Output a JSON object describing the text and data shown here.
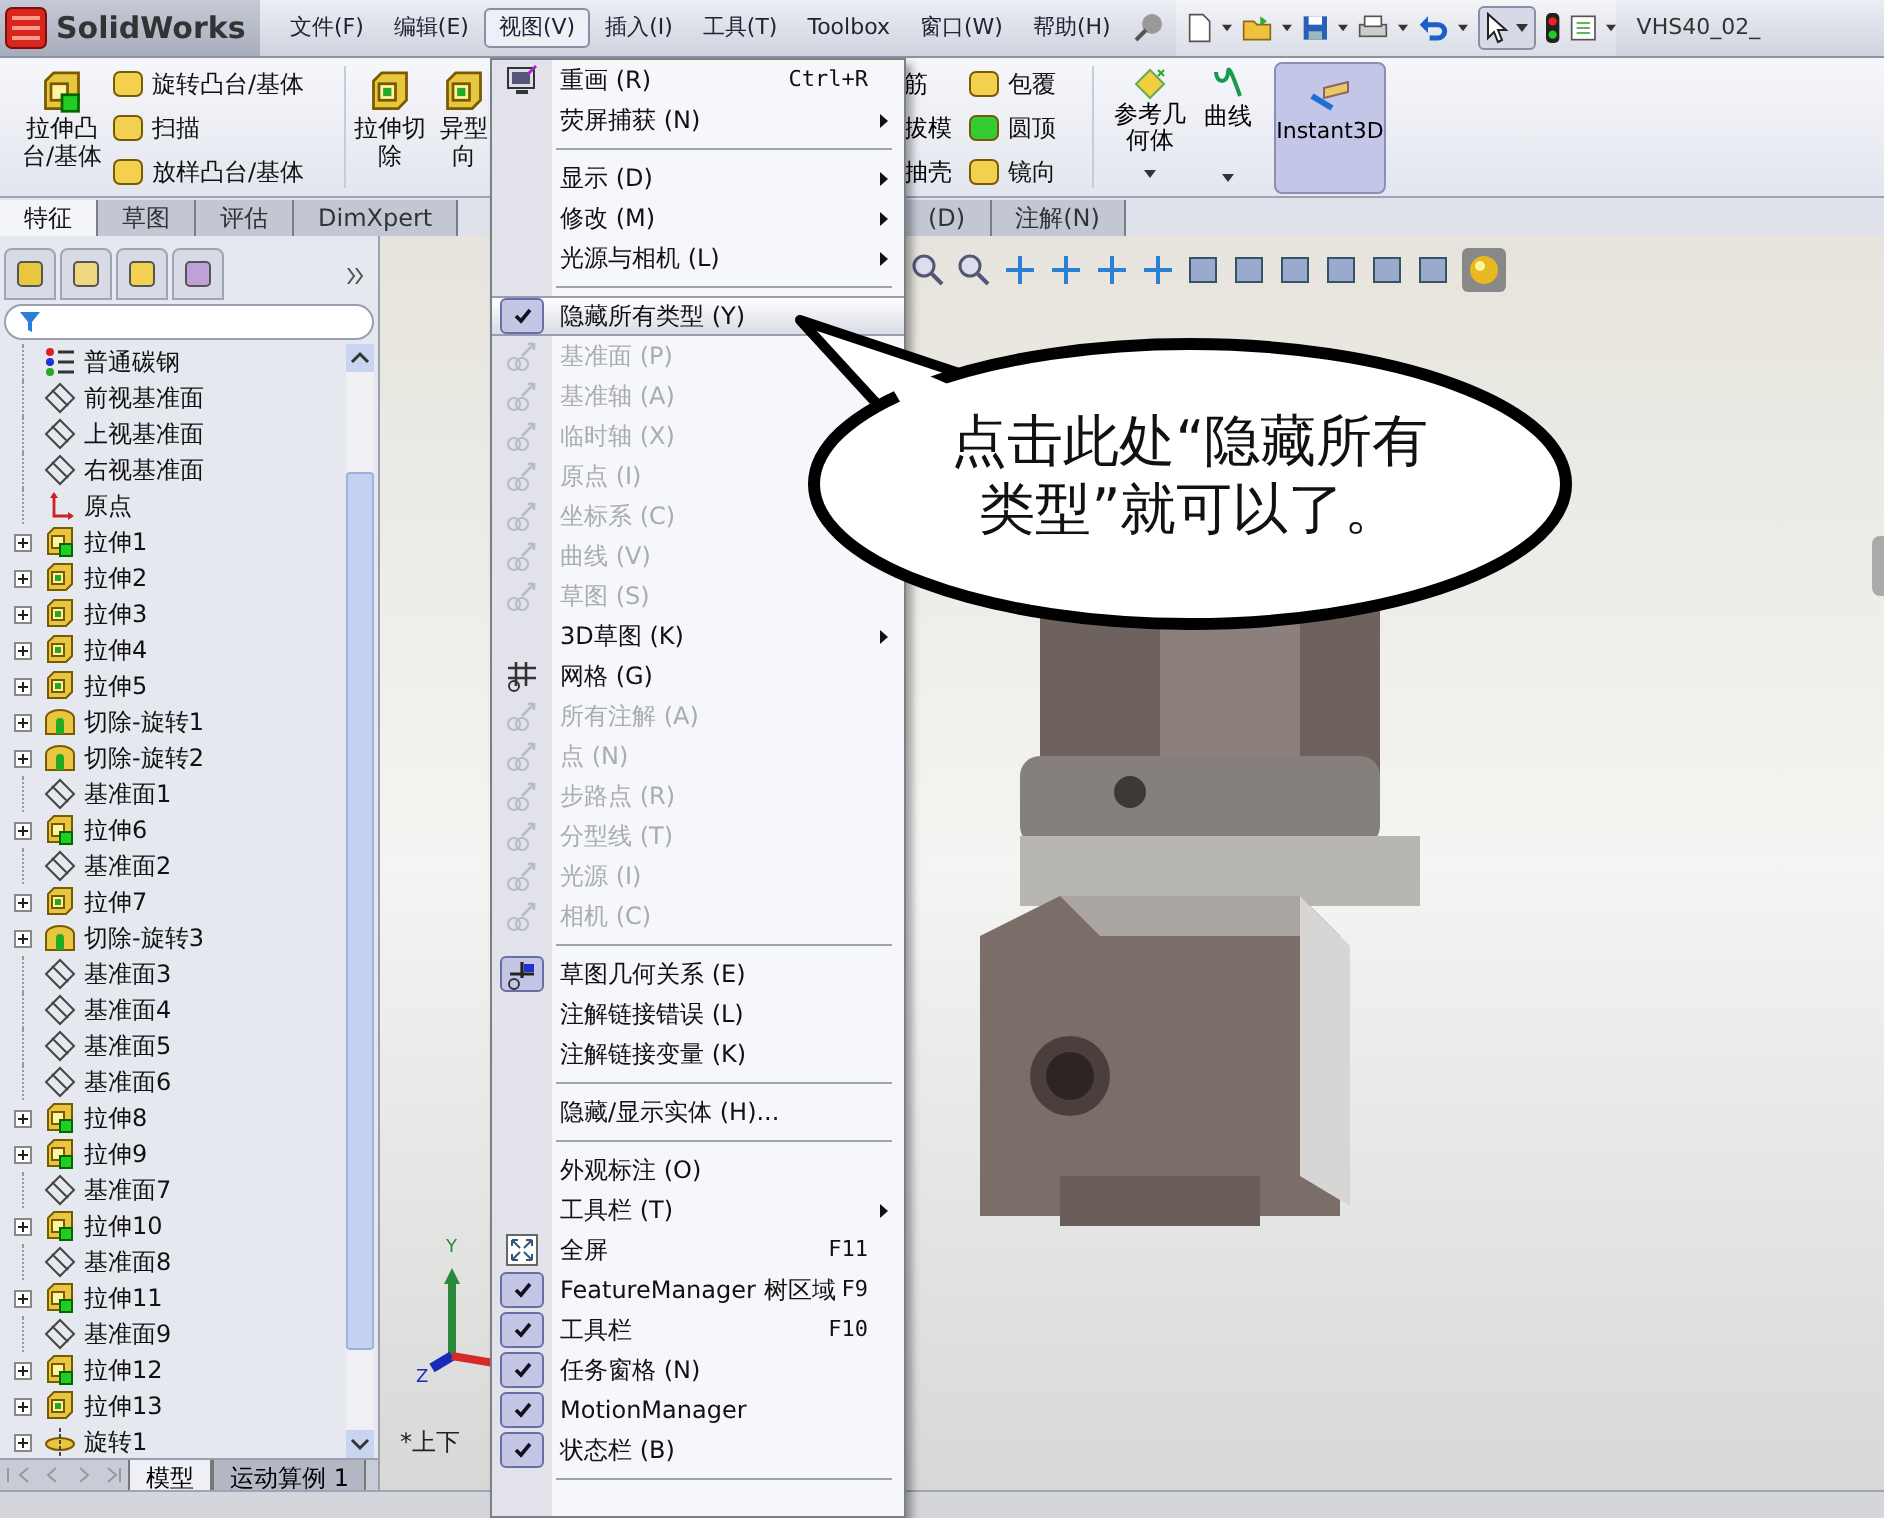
{
  "title_bar": {
    "app_name": "SolidWorks",
    "document": "VHS40_02_"
  },
  "menu_bar": [
    {
      "label": "文件(F)",
      "selected": false
    },
    {
      "label": "编辑(E)",
      "selected": false
    },
    {
      "label": "视图(V)",
      "selected": true
    },
    {
      "label": "插入(I)",
      "selected": false
    },
    {
      "label": "工具(T)",
      "selected": false
    },
    {
      "label": "Toolbox",
      "selected": false
    },
    {
      "label": "窗口(W)",
      "selected": false
    },
    {
      "label": "帮助(H)",
      "selected": false
    }
  ],
  "ribbon": {
    "left_large": "拉伸凸台/基体",
    "left_small": [
      "旋转凸台/基体",
      "扫描",
      "放样凸台/基体"
    ],
    "cut_large": "拉伸切除",
    "hole_partial": "异型向",
    "right_small_a": [
      "筋",
      "拔模",
      "抽壳"
    ],
    "right_small_b": [
      "包覆",
      "圆顶",
      "镜向"
    ],
    "reference": "参考几何体",
    "curves": "曲线",
    "instant3d": {
      "label": "Instant3D",
      "on": true
    }
  },
  "ribbon_tabs_left": [
    {
      "label": "特征",
      "selected": true
    },
    {
      "label": "草图",
      "selected": false
    },
    {
      "label": "评估",
      "selected": false
    },
    {
      "label": "DimXpert",
      "selected": false
    }
  ],
  "ribbon_tabs_right": [
    {
      "label": "(D)",
      "selected": false
    },
    {
      "label": "注解(N)",
      "selected": false
    }
  ],
  "feature_tree": [
    {
      "label": "普通碳钢",
      "kind": "material",
      "expandable": false
    },
    {
      "label": "前视基准面",
      "kind": "plane",
      "expandable": false
    },
    {
      "label": "上视基准面",
      "kind": "plane",
      "expandable": false
    },
    {
      "label": "右视基准面",
      "kind": "plane",
      "expandable": false
    },
    {
      "label": "原点",
      "kind": "origin",
      "expandable": false
    },
    {
      "label": "拉伸1",
      "kind": "boss",
      "expandable": true
    },
    {
      "label": "拉伸2",
      "kind": "extrude",
      "expandable": true
    },
    {
      "label": "拉伸3",
      "kind": "extrude",
      "expandable": true
    },
    {
      "label": "拉伸4",
      "kind": "extrude",
      "expandable": true
    },
    {
      "label": "拉伸5",
      "kind": "extrude",
      "expandable": true
    },
    {
      "label": "切除-旋转1",
      "kind": "revolve_cut",
      "expandable": true
    },
    {
      "label": "切除-旋转2",
      "kind": "revolve_cut",
      "expandable": true
    },
    {
      "label": "基准面1",
      "kind": "plane",
      "expandable": false
    },
    {
      "label": "拉伸6",
      "kind": "boss",
      "expandable": true
    },
    {
      "label": "基准面2",
      "kind": "plane",
      "expandable": false
    },
    {
      "label": "拉伸7",
      "kind": "extrude",
      "expandable": true
    },
    {
      "label": "切除-旋转3",
      "kind": "revolve_cut",
      "expandable": true
    },
    {
      "label": "基准面3",
      "kind": "plane",
      "expandable": false
    },
    {
      "label": "基准面4",
      "kind": "plane",
      "expandable": false
    },
    {
      "label": "基准面5",
      "kind": "plane",
      "expandable": false
    },
    {
      "label": "基准面6",
      "kind": "plane",
      "expandable": false
    },
    {
      "label": "拉伸8",
      "kind": "boss",
      "expandable": true
    },
    {
      "label": "拉伸9",
      "kind": "boss",
      "expandable": true
    },
    {
      "label": "基准面7",
      "kind": "plane",
      "expandable": false
    },
    {
      "label": "拉伸10",
      "kind": "boss",
      "expandable": true
    },
    {
      "label": "基准面8",
      "kind": "plane",
      "expandable": false
    },
    {
      "label": "拉伸11",
      "kind": "boss",
      "expandable": true
    },
    {
      "label": "基准面9",
      "kind": "plane",
      "expandable": false
    },
    {
      "label": "拉伸12",
      "kind": "boss",
      "expandable": true
    },
    {
      "label": "拉伸13",
      "kind": "extrude",
      "expandable": true
    },
    {
      "label": "旋转1",
      "kind": "revolve",
      "expandable": true
    }
  ],
  "bottom_tabs": [
    {
      "label": "模型",
      "selected": true
    },
    {
      "label": "运动算例 1",
      "selected": false
    }
  ],
  "view_menu": [
    {
      "kind": "redraw",
      "label": "重画 (R)",
      "shortcut": "Ctrl+R",
      "submenu": false,
      "disabled": false,
      "checked": false,
      "highlighted": false
    },
    {
      "kind": "plain",
      "label": "荧屏捕获 (N)",
      "submenu": true,
      "disabled": false,
      "checked": false,
      "highlighted": false
    },
    {
      "kind": "separator"
    },
    {
      "kind": "plain",
      "label": "显示 (D)",
      "submenu": true,
      "disabled": false,
      "checked": false,
      "highlighted": false
    },
    {
      "kind": "plain",
      "label": "修改 (M)",
      "submenu": true,
      "disabled": false,
      "checked": false,
      "highlighted": false
    },
    {
      "kind": "plain",
      "label": "光源与相机 (L)",
      "submenu": true,
      "disabled": false,
      "checked": false,
      "highlighted": false
    },
    {
      "kind": "separator"
    },
    {
      "kind": "plain",
      "label": "隐藏所有类型 (Y)",
      "submenu": false,
      "disabled": false,
      "checked": true,
      "highlighted": true
    },
    {
      "kind": "entity",
      "label": "基准面 (P)",
      "submenu": false,
      "disabled": true,
      "checked": false,
      "highlighted": false
    },
    {
      "kind": "entity",
      "label": "基准轴 (A)",
      "submenu": false,
      "disabled": true,
      "checked": false,
      "highlighted": false
    },
    {
      "kind": "entity",
      "label": "临时轴 (X)",
      "submenu": false,
      "disabled": true,
      "checked": false,
      "highlighted": false
    },
    {
      "kind": "entity",
      "label": "原点 (I)",
      "submenu": false,
      "disabled": true,
      "checked": false,
      "highlighted": false
    },
    {
      "kind": "entity",
      "label": "坐标系 (C)",
      "submenu": false,
      "disabled": true,
      "checked": false,
      "highlighted": false
    },
    {
      "kind": "entity",
      "label": "曲线 (V)",
      "submenu": false,
      "disabled": true,
      "checked": false,
      "highlighted": false
    },
    {
      "kind": "entity",
      "label": "草图 (S)",
      "submenu": false,
      "disabled": true,
      "checked": false,
      "highlighted": false
    },
    {
      "kind": "plain",
      "label": "3D草图 (K)",
      "submenu": true,
      "disabled": false,
      "checked": false,
      "highlighted": false
    },
    {
      "kind": "grid",
      "label": "网格 (G)",
      "submenu": false,
      "disabled": false,
      "checked": false,
      "highlighted": false
    },
    {
      "kind": "entity",
      "label": "所有注解 (A)",
      "submenu": false,
      "disabled": true,
      "checked": false,
      "highlighted": false
    },
    {
      "kind": "entity",
      "label": "点 (N)",
      "submenu": false,
      "disabled": true,
      "checked": false,
      "highlighted": false
    },
    {
      "kind": "entity",
      "label": "步路点 (R)",
      "submenu": false,
      "disabled": true,
      "checked": false,
      "highlighted": false
    },
    {
      "kind": "entity",
      "label": "分型线 (T)",
      "submenu": false,
      "disabled": true,
      "checked": false,
      "highlighted": false
    },
    {
      "kind": "entity",
      "label": "光源 (I)",
      "submenu": false,
      "disabled": true,
      "checked": false,
      "highlighted": false
    },
    {
      "kind": "entity",
      "label": "相机 (C)",
      "submenu": false,
      "disabled": true,
      "checked": false,
      "highlighted": false
    },
    {
      "kind": "separator"
    },
    {
      "kind": "relation",
      "label": "草图几何关系 (E)",
      "submenu": false,
      "disabled": false,
      "checked": true,
      "highlighted": false
    },
    {
      "kind": "plain",
      "label": "注解链接错误 (L)",
      "submenu": false,
      "disabled": false,
      "checked": false,
      "highlighted": false
    },
    {
      "kind": "plain",
      "label": "注解链接变量 (K)",
      "submenu": false,
      "disabled": false,
      "checked": false,
      "highlighted": false
    },
    {
      "kind": "separator"
    },
    {
      "kind": "plain",
      "label": "隐藏/显示实体 (H)...",
      "submenu": false,
      "disabled": false,
      "checked": false,
      "highlighted": false
    },
    {
      "kind": "separator"
    },
    {
      "kind": "plain",
      "label": "外观标注 (O)",
      "submenu": false,
      "disabled": false,
      "checked": false,
      "highlighted": false
    },
    {
      "kind": "plain",
      "label": "工具栏 (T)",
      "submenu": true,
      "disabled": false,
      "checked": false,
      "highlighted": false
    },
    {
      "kind": "fullscreen",
      "label": "全屏",
      "shortcut": "F11",
      "submenu": false,
      "disabled": false,
      "checked": false,
      "highlighted": false
    },
    {
      "kind": "plain",
      "label": "FeatureManager 树区域",
      "shortcut": "F9",
      "submenu": false,
      "disabled": false,
      "checked": true,
      "highlighted": false
    },
    {
      "kind": "plain",
      "label": "工具栏",
      "shortcut": "F10",
      "submenu": false,
      "disabled": false,
      "checked": true,
      "highlighted": false
    },
    {
      "kind": "plain",
      "label": "任务窗格 (N)",
      "submenu": false,
      "disabled": false,
      "checked": true,
      "highlighted": false
    },
    {
      "kind": "plain",
      "label": "MotionManager",
      "submenu": false,
      "disabled": false,
      "checked": true,
      "highlighted": false
    },
    {
      "kind": "plain",
      "label": "状态栏 (B)",
      "submenu": false,
      "disabled": false,
      "checked": true,
      "highlighted": false
    },
    {
      "kind": "separator"
    }
  ],
  "callout": {
    "text": "点击此处“隐藏所有类型”就可以了。"
  },
  "viewport": {
    "triad_y": "Y",
    "triad_z": "Z",
    "view_label": "*上下"
  }
}
